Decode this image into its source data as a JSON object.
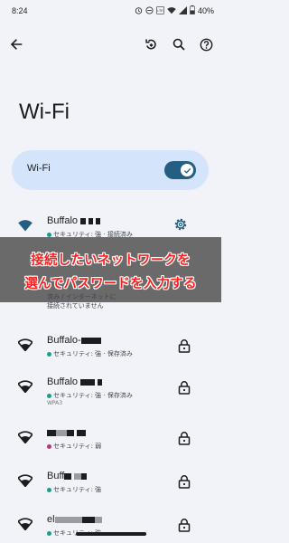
{
  "status_bar": {
    "time": "8:24",
    "battery": "40%"
  },
  "page": {
    "title": "Wi-Fi"
  },
  "wifi_toggle": {
    "label": "Wi-Fi",
    "on": true
  },
  "networks": [
    {
      "name": "Buffalo",
      "status": "セキュリティ: 強 · 接続済み",
      "dot_color": "#1a9e8a",
      "action": "gear-icon"
    },
    {
      "name": "Buffalo-",
      "status": "セキュリティ: 強 · 保存済み",
      "dot_color": "#1a9e8a",
      "action": "lock-icon"
    },
    {
      "name": "Buffalo",
      "status": "セキュリティ: 強 · 保存済み",
      "dot_color": "#1a9e8a",
      "action": "lock-icon"
    },
    {
      "name": "",
      "status": "セキュリティ: 弱",
      "dot_color": "#b5397a",
      "action": "lock-icon"
    },
    {
      "name": "Buff",
      "status": "セキュリティ: 強",
      "dot_color": "#1a9e8a",
      "action": "lock-icon"
    },
    {
      "name": "el",
      "status": "セキュリティ: 強",
      "dot_color": "#1a9e8a",
      "action": "lock-icon"
    }
  ],
  "hidden_text": {
    "line1": "済み / インターネットに",
    "line2": "接続されていません",
    "fragment": "WPA3"
  },
  "banner": {
    "line1": "接続したいネットワークを",
    "line2": "選んでパスワードを入力する",
    "text_color": "#ff1f1f"
  }
}
